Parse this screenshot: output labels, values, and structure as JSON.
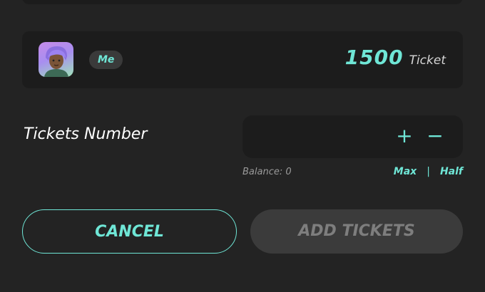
{
  "user": {
    "badge": "Me",
    "balance_amount": "1500",
    "balance_unit": "Ticket"
  },
  "tickets": {
    "label": "Tickets Number",
    "input_value": "",
    "plus_symbol": "+",
    "minus_symbol": "−",
    "balance_text": "Balance: 0",
    "max_label": "Max",
    "separator": "|",
    "half_label": "Half"
  },
  "actions": {
    "cancel_label": "CANCEL",
    "add_label": "ADD TICKETS"
  },
  "colors": {
    "accent": "#6fe6d6",
    "background": "#232323",
    "card": "#1c1c1c",
    "disabled_button": "#3b3b3b"
  },
  "icons": {
    "plus": "plus-icon",
    "minus": "minus-icon"
  }
}
